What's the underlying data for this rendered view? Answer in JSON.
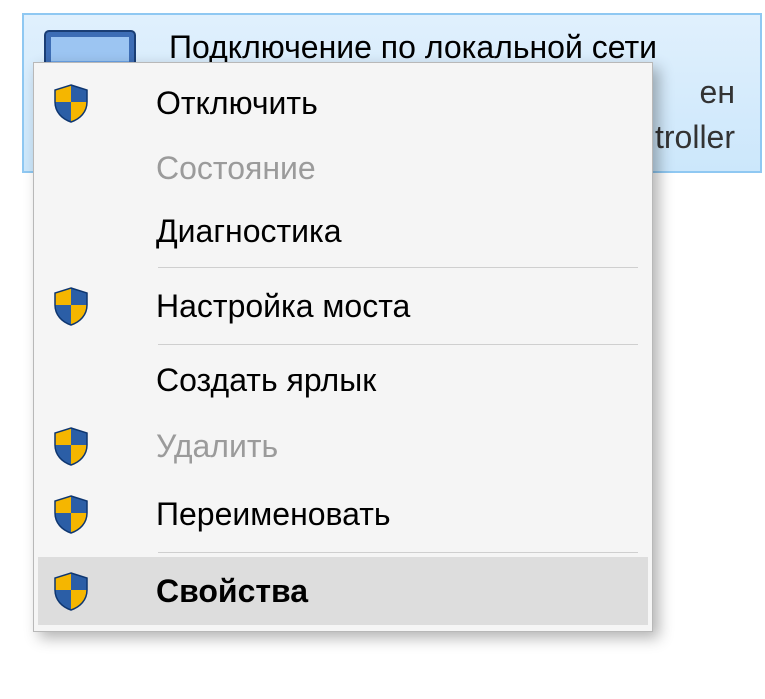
{
  "network": {
    "title": "Подключение по локальной сети",
    "line2_visible": "ен",
    "line3_visible": "troller"
  },
  "menu": {
    "items": [
      {
        "label": "Отключить",
        "shield": true,
        "disabled": false,
        "bold": false,
        "hover": false
      },
      {
        "label": "Состояние",
        "shield": false,
        "disabled": true,
        "bold": false,
        "hover": false
      },
      {
        "label": "Диагностика",
        "shield": false,
        "disabled": false,
        "bold": false,
        "hover": false
      },
      {
        "label": "Настройка моста",
        "shield": true,
        "disabled": false,
        "bold": false,
        "hover": false
      },
      {
        "label": "Создать ярлык",
        "shield": false,
        "disabled": false,
        "bold": false,
        "hover": false
      },
      {
        "label": "Удалить",
        "shield": true,
        "disabled": true,
        "bold": false,
        "hover": false
      },
      {
        "label": "Переименовать",
        "shield": true,
        "disabled": false,
        "bold": false,
        "hover": false
      },
      {
        "label": "Свойства",
        "shield": true,
        "disabled": false,
        "bold": true,
        "hover": true
      }
    ]
  }
}
